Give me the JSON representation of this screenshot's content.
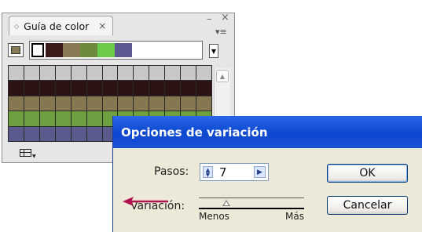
{
  "panel": {
    "tab_label": "Guía de color",
    "grip": "◇",
    "close": "×",
    "min_glyph": "–",
    "close_glyph": "×",
    "menu_glyph": "▾≡",
    "harmony_colors": [
      "#000000",
      "#3d1a1a",
      "#8b7b55",
      "#6e8a3c",
      "#6ccb4a",
      "#5d5890"
    ],
    "base_color": "#8b7b55",
    "grid": [
      [
        "#c8c8c8",
        "#c8c8c8",
        "#c8c8c8",
        "#c8c8c8",
        "#c8c8c8",
        "#c8c8c8",
        "#c8c8c8",
        "#c8c8c8",
        "#c8c8c8",
        "#c8c8c8",
        "#c8c8c8",
        "#c8c8c8",
        "#c8c8c8"
      ],
      [
        "#2c1313",
        "#2c1313",
        "#2c1313",
        "#2c1313",
        "#2c1313",
        "#2c1313",
        "#2c1313",
        "#2c1313",
        "#2c1313",
        "#2c1313",
        "#2c1313",
        "#2c1313",
        "#2c1313"
      ],
      [
        "#857752",
        "#857752",
        "#857752",
        "#857752",
        "#857752",
        "#857752",
        "#857752",
        "#857752",
        "#857752",
        "#857752",
        "#857752",
        "#857752",
        "#857752"
      ],
      [
        "#6ea042",
        "#6ea042",
        "#6ea042",
        "#6ea042",
        "#6ea042",
        "#6ea042",
        "#6ea042",
        "#6ea042",
        "#6ea042",
        "#6ea042",
        "#6ea042",
        "#6ea042",
        "#6ea042"
      ],
      [
        "#5b5a8d",
        "#5b5a8d",
        "#5b5a8d",
        "#5b5a8d",
        "#5b5a8d",
        "#5b5a8d",
        "#5b5a8d",
        "#5b5a8d",
        "#5b5a8d",
        "#5b5a8d",
        "#5b5a8d",
        "#5b5a8d",
        "#5b5a8d"
      ]
    ]
  },
  "dialog": {
    "title": "Opciones de variación",
    "steps_label": "Pasos:",
    "steps_value": "7",
    "variation_label": "Variación:",
    "min_label": "Menos",
    "max_label": "Más",
    "ok_label": "OK",
    "cancel_label": "Cancelar",
    "arrow_color": "#b0124e"
  }
}
